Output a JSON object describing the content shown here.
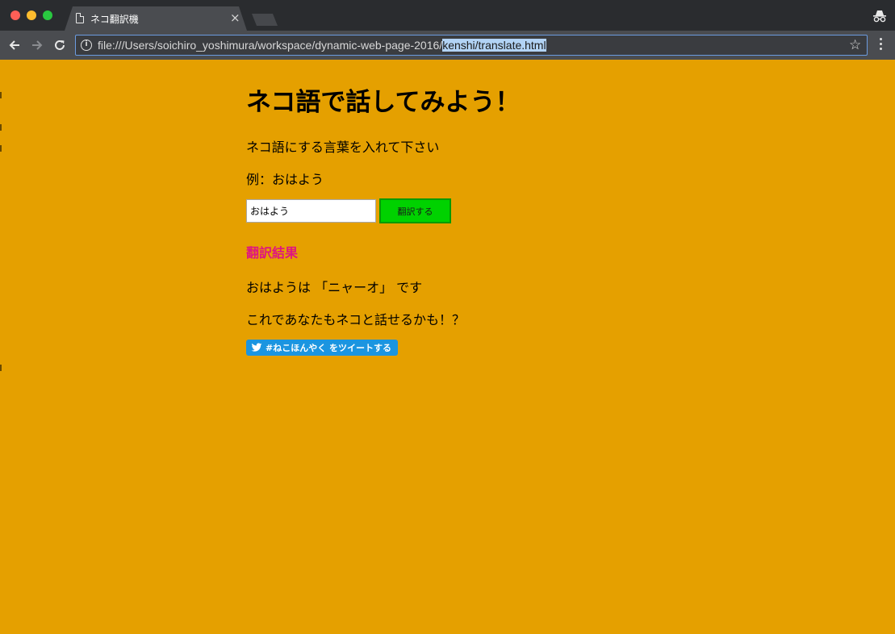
{
  "browser": {
    "tab_title": "ネコ翻訳機",
    "tab_close": "×",
    "url_prefix": "file:///Users/soichiro_yoshimura/workspace/dynamic-web-page-2016/",
    "url_selected": "kenshi/translate.html",
    "icons": {
      "info": "info-icon",
      "star": "star-icon",
      "back": "back-arrow-icon",
      "forward": "forward-arrow-icon",
      "reload": "reload-icon",
      "incognito": "incognito-icon",
      "menu": "menu-icon"
    }
  },
  "page": {
    "title": "ネコ語で話してみよう！",
    "instruction": "ネコ語にする言葉を入れて下さい",
    "example": "例：おはよう",
    "input_value": "おはよう",
    "translate_button": "翻訳する",
    "result_heading": "翻訳結果",
    "result_text": "おはようは 「ニャーオ」 です",
    "closing_text": "これであなたもネコと話せるかも！？",
    "tweet_button": "#ねこほんやく をツイートする"
  },
  "colors": {
    "page_background": "#e5a000",
    "button_green": "#00d200",
    "result_heading": "#e01580",
    "tweet_blue": "#1b95e0"
  }
}
